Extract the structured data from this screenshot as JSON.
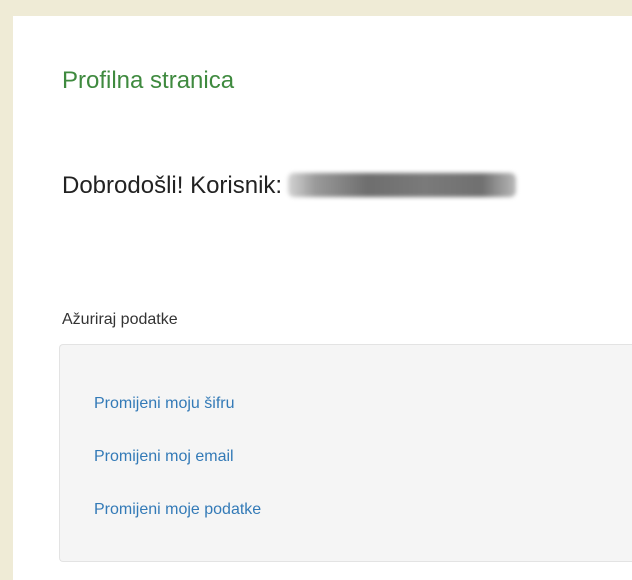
{
  "colors": {
    "page_background": "#efebd6",
    "panel_background": "#ffffff",
    "title": "#3f8a3f",
    "link": "#337ab7",
    "well_background": "#f5f5f5"
  },
  "header": {
    "title": "Profilna stranica"
  },
  "welcome": {
    "text": "Dobrodošli! Korisnik:"
  },
  "update_section": {
    "label": "Ažuriraj podatke",
    "links": [
      {
        "label": "Promijeni moju šifru"
      },
      {
        "label": "Promijeni moj email"
      },
      {
        "label": "Promijeni moje podatke"
      }
    ]
  }
}
